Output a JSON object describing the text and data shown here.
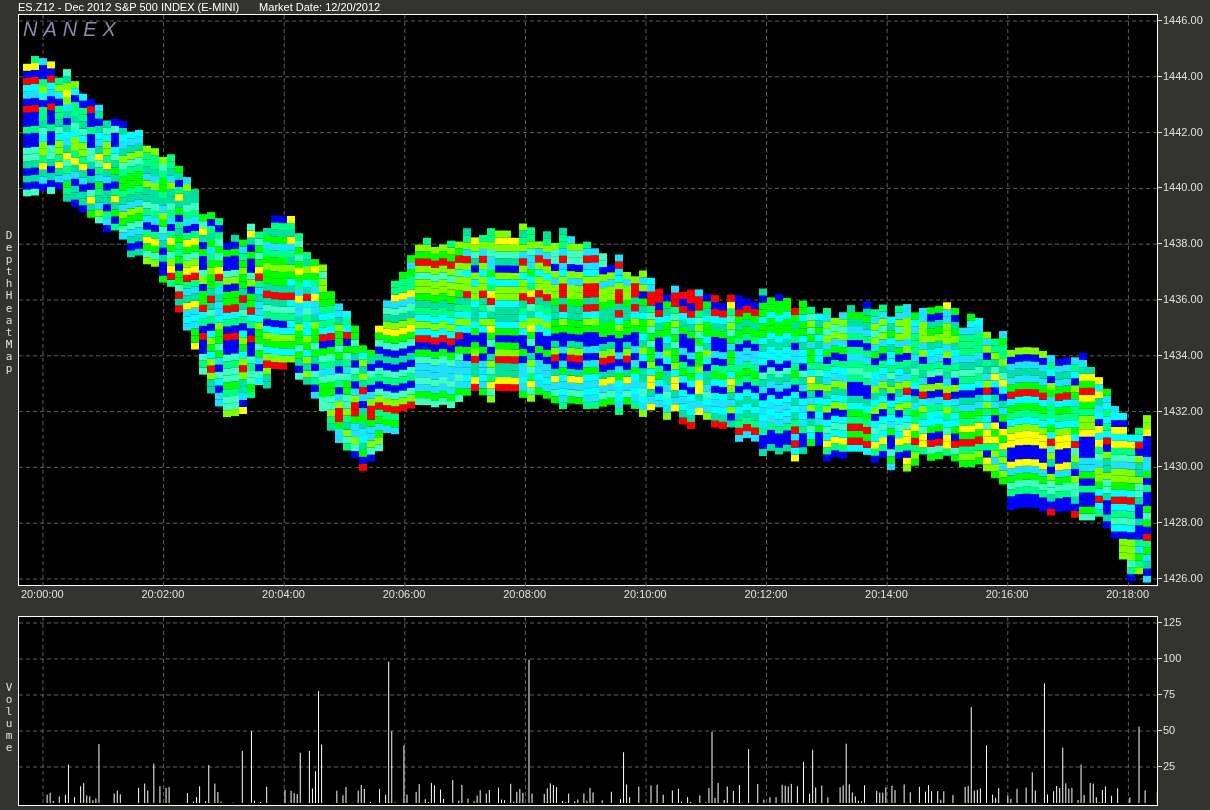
{
  "title": "ES.Z12 - Dec 2012 S&P 500 INDEX (E-MINI)",
  "market_date": "Market Date: 12/20/2012",
  "heat_panel": {
    "watermark": "NANEX",
    "axis_title": "Depth Heat Map",
    "y_ticks": [
      "1446.00",
      "1444.00",
      "1442.00",
      "1440.00",
      "1438.00",
      "1436.00",
      "1434.00",
      "1432.00",
      "1430.00",
      "1428.00",
      "1426.00"
    ]
  },
  "x_ticks": [
    "20:00:00",
    "20:02:00",
    "20:04:00",
    "20:06:00",
    "20:08:00",
    "20:10:00",
    "20:12:00",
    "20:14:00",
    "20:16:00",
    "20:18:00"
  ],
  "volume_panel": {
    "axis_title": "Volume",
    "y_ticks": [
      "125",
      "100",
      "75",
      "50",
      "25"
    ]
  }
}
